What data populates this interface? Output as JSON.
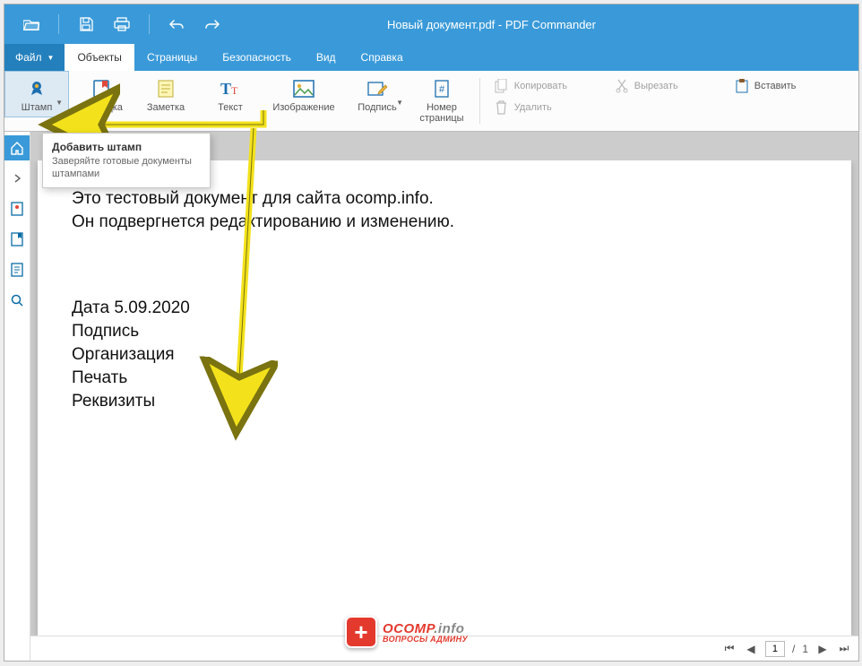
{
  "title": "Новый документ.pdf - PDF Commander",
  "menu": {
    "file": "Файл",
    "tabs": [
      "Объекты",
      "Страницы",
      "Безопасность",
      "Вид",
      "Справка"
    ]
  },
  "ribbon": {
    "stamp": "Штамп",
    "bookmark": "Закладка",
    "note": "Заметка",
    "text": "Текст",
    "image": "Изображение",
    "signature": "Подпись",
    "pagenum": "Номер\nстраницы"
  },
  "ribbon_right": {
    "copy": "Копировать",
    "cut": "Вырезать",
    "paste": "Вставить",
    "delete": "Удалить"
  },
  "tooltip": {
    "title": "Добавить штамп",
    "desc": "Заверяйте готовые документы штампами"
  },
  "document": {
    "line1": "Это тестовый документ для сайта ocomp.info.",
    "line2": "Он подвергнется редактированию и изменению.",
    "line3": "Дата  5.09.2020",
    "line4": "Подпись",
    "line5": "Организация",
    "line6": "Печать",
    "line7": "Реквизиты"
  },
  "footer": {
    "page_current": "1",
    "page_sep": "/",
    "page_total": "1"
  },
  "watermark": {
    "brand1": "OCOMP",
    "brand2": ".info",
    "sub": "ВОПРОСЫ АДМИНУ"
  }
}
